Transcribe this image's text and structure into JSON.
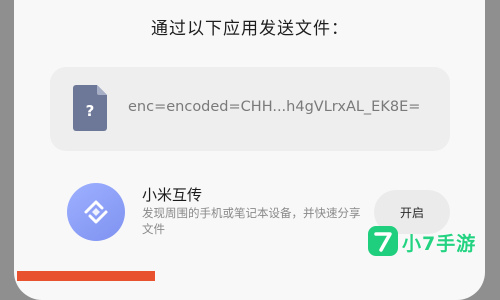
{
  "dialog": {
    "title": "通过以下应用发送文件："
  },
  "file": {
    "icon": "document-unknown-icon",
    "name": "enc=encoded=CHH...h4gVLrxAL_EK8E="
  },
  "apps": [
    {
      "icon": "mi-share-icon",
      "name": "小米互传",
      "description": "发现周围的手机或笔记本设备，并快速分享文件",
      "action_label": "开启"
    }
  ],
  "watermark": {
    "text": "小7手游"
  },
  "colors": {
    "background": "#8f8f8f",
    "sheet": "#f8f8f8",
    "file_card": "#eeeeee",
    "file_icon": "#6d7898",
    "app_icon": "#8ea2fa",
    "bottom_bar": "#e8522f",
    "watermark": "#24d382"
  }
}
